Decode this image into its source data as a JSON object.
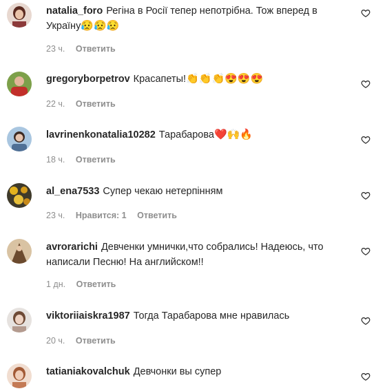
{
  "comments": [
    {
      "username": "natalia_foro",
      "text": "Регіна в Росії тепер непотрібна. Тож вперед в Україну",
      "emojis": "😥😥😥",
      "time": "23 ч.",
      "likes": "",
      "reply": "Ответить",
      "avatar_color": "#8c3a3a"
    },
    {
      "username": "gregoryborpetrov",
      "text": "Красапеты!",
      "emojis": "👏👏👏😍😍😍",
      "time": "22 ч.",
      "likes": "",
      "reply": "Ответить",
      "avatar_color": "#b8312f"
    },
    {
      "username": "lavrinenkonatalia10282",
      "text": "Тарабарова",
      "emojis": "❤️🙌🔥",
      "time": "18 ч.",
      "likes": "",
      "reply": "Ответить",
      "avatar_color": "#6b8fb8"
    },
    {
      "username": "al_ena7533",
      "text": "Супер чекаю нетерпінням",
      "emojis": "",
      "time": "23 ч.",
      "likes": "Нравится: 1",
      "reply": "Ответить",
      "avatar_color": "#c99a2e"
    },
    {
      "username": "avrorarichi",
      "text": "Девченки умнички,что собрались! Надеюсь, что написали Песню! На английском!!",
      "emojis": "",
      "time": "1 дн.",
      "likes": "",
      "reply": "Ответить",
      "avatar_color": "#7a5a3a"
    },
    {
      "username": "viktoriiaiskra1987",
      "text": "Тогда Тарабарова мне нравилась",
      "emojis": "",
      "time": "20 ч.",
      "likes": "",
      "reply": "Ответить",
      "avatar_color": "#a8897a"
    },
    {
      "username": "tatianiakovalchuk",
      "text": "Девчонки вы супер",
      "emojis": "",
      "time": "",
      "likes": "",
      "reply": "",
      "avatar_color": "#c47a55"
    }
  ]
}
